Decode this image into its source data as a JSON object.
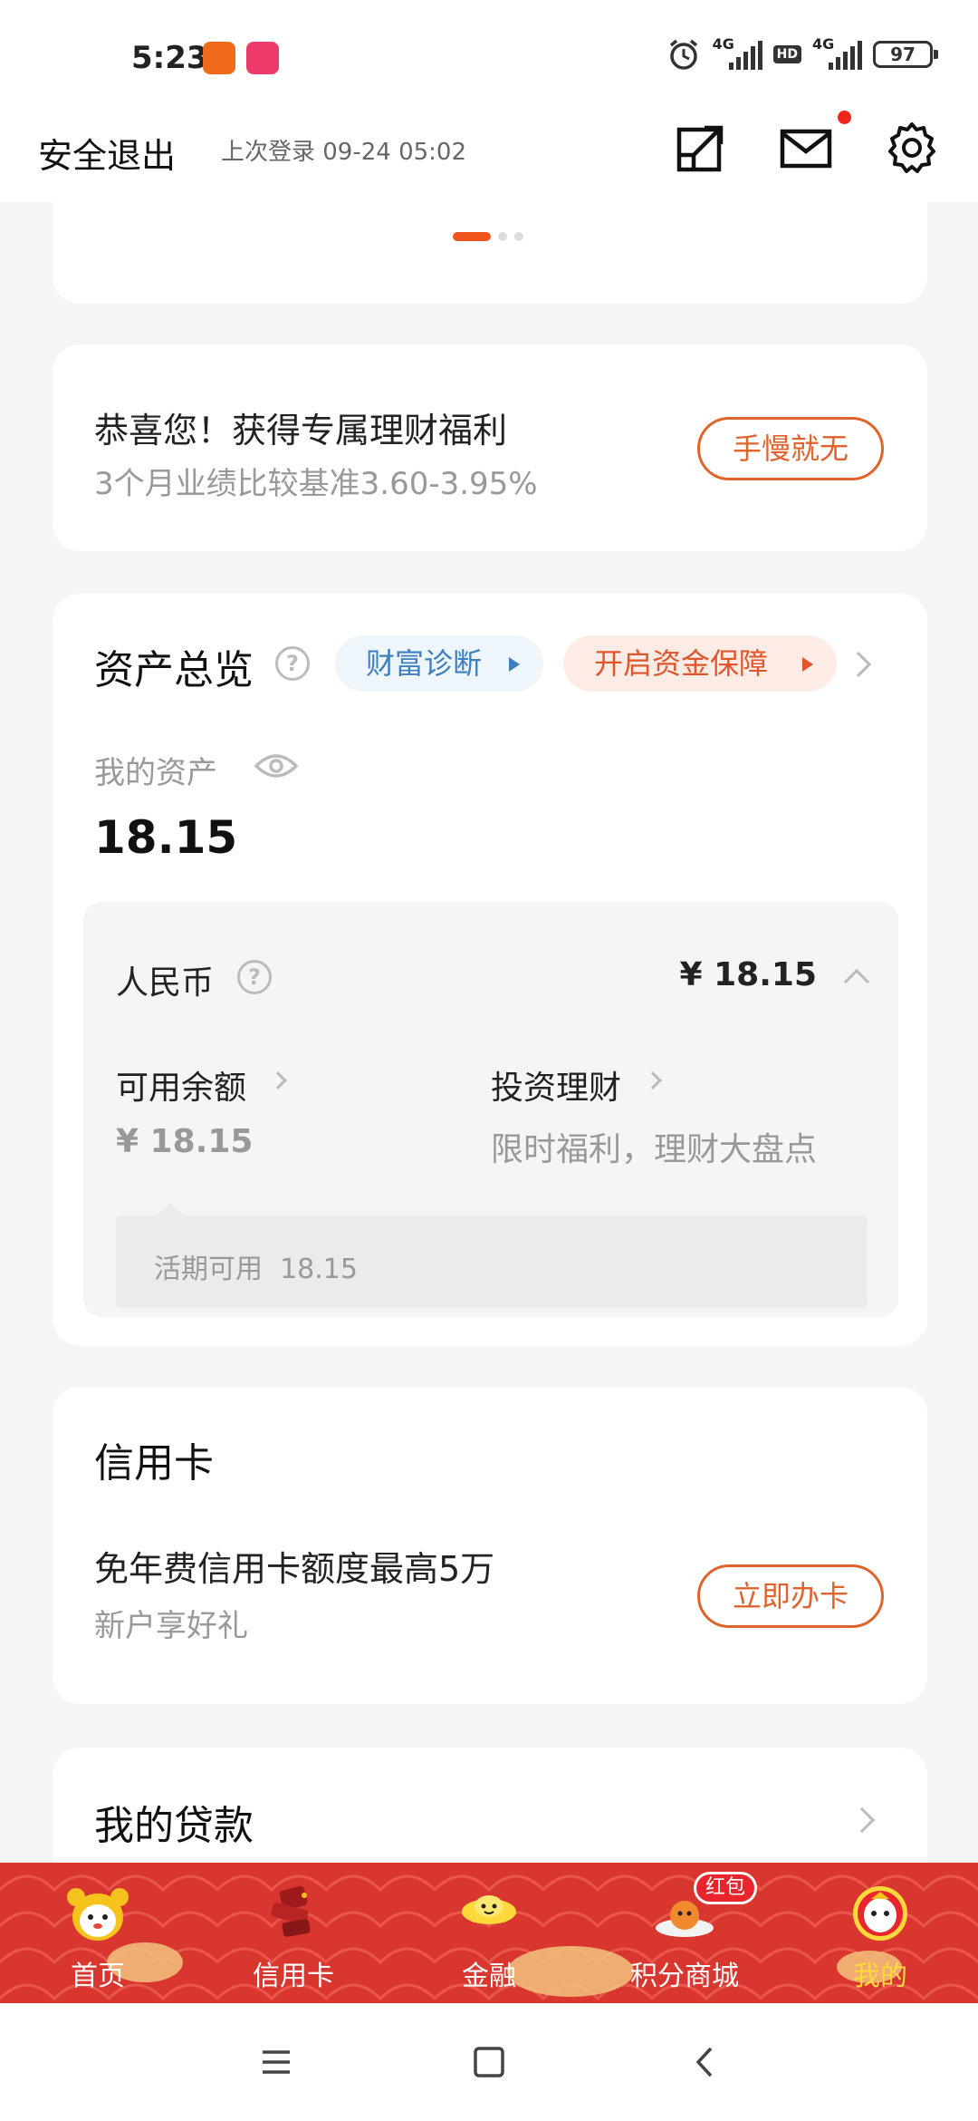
{
  "status_bar": {
    "time": "5:23",
    "signal1": "4G",
    "hd": "HD",
    "signal2": "4G",
    "battery": "97"
  },
  "header": {
    "logout": "安全退出",
    "last_login": "上次登录 09-24 05:02",
    "icons": [
      "share-icon",
      "mail-icon",
      "settings-icon"
    ]
  },
  "promo": {
    "title": "恭喜您！获得专属理财福利",
    "subtitle": "3个月业绩比较基准3.60-3.95%",
    "button": "手慢就无"
  },
  "assets": {
    "title": "资产总览",
    "help": "?",
    "diagnosis": "财富诊断",
    "protection": "开启资金保障",
    "my_assets_label": "我的资产",
    "my_assets_value": "18.15",
    "currency": {
      "label": "人民币",
      "value": "¥ 18.15",
      "available_label": "可用余额",
      "available_value": "¥ 18.15",
      "invest_label": "投资理财",
      "invest_sub": "限时福利，理财大盘点",
      "tip": "活期可用  18.15"
    }
  },
  "credit_card": {
    "title": "信用卡",
    "main": "免年费信用卡额度最高5万",
    "sub": "新户享好礼",
    "button": "立即办卡"
  },
  "loan": {
    "title": "我的贷款"
  },
  "bottom_nav": {
    "items": [
      {
        "label": "首页",
        "icon": "home-mascot-icon"
      },
      {
        "label": "信用卡",
        "icon": "credit-card-icon"
      },
      {
        "label": "金融",
        "icon": "gold-ingot-icon"
      },
      {
        "label": "积分商城",
        "icon": "points-mall-icon"
      },
      {
        "label": "我的",
        "icon": "profile-mascot-icon"
      }
    ],
    "badge": "红包",
    "active": "我的",
    "colors": {
      "bar": "#d8362e",
      "active_label": "#ffd93b"
    }
  },
  "colors": {
    "accent": "#e0632c",
    "pill_blue": "#3d7fbf"
  }
}
